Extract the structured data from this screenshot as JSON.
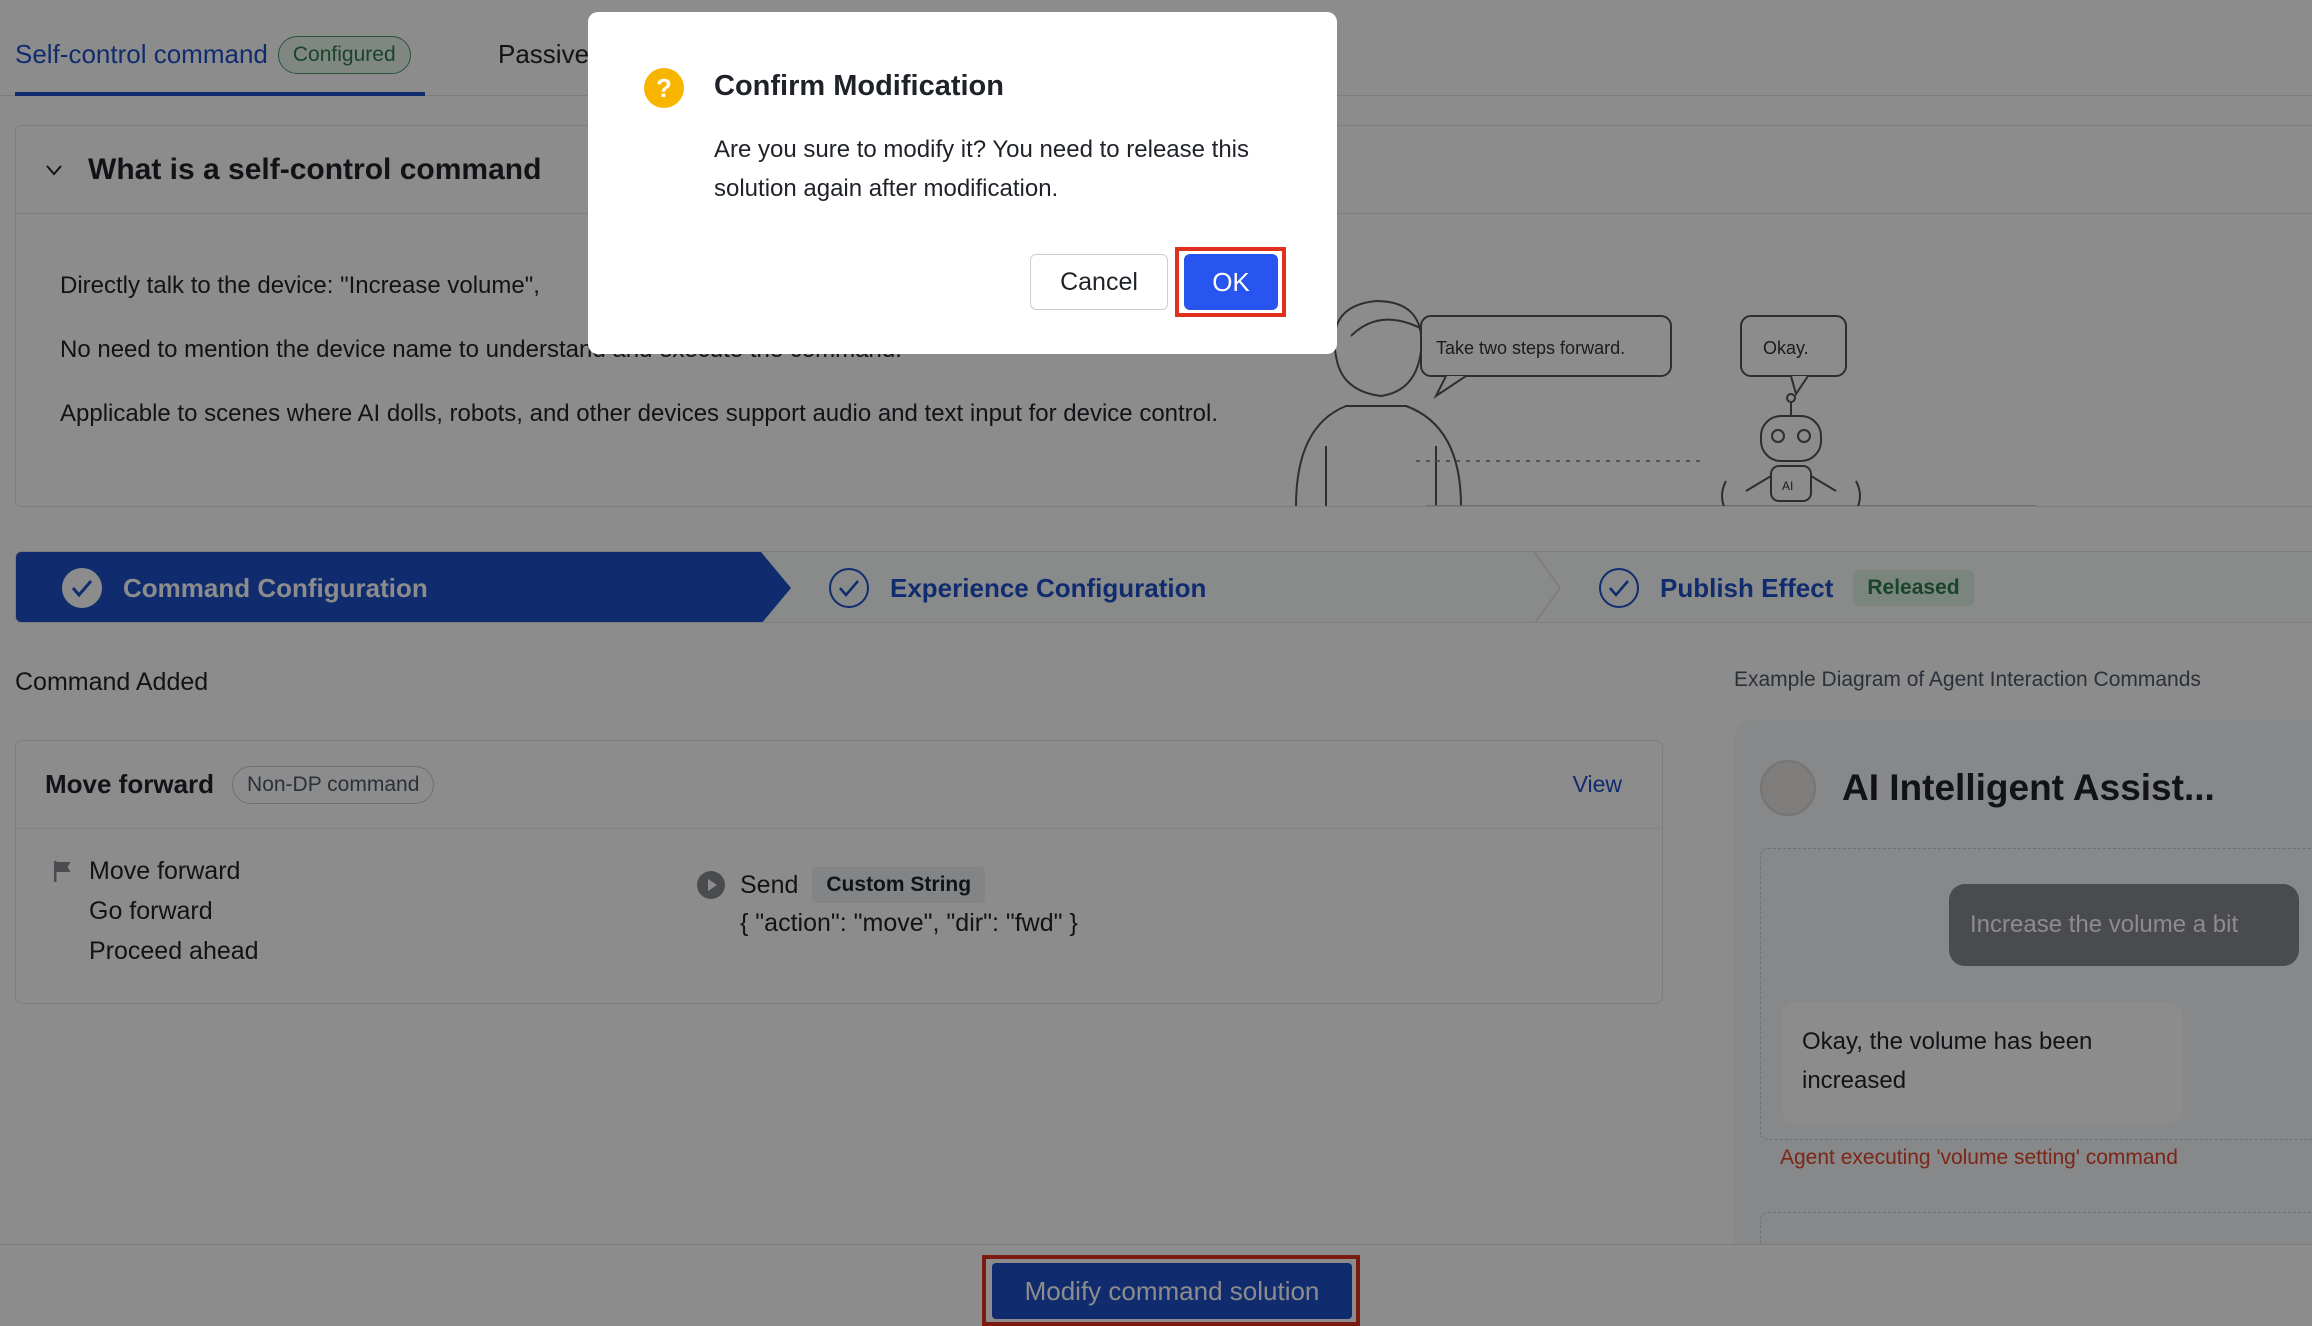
{
  "tabs": {
    "active_label": "Self-control command",
    "active_badge": "Configured",
    "second_label": "Passive"
  },
  "intro": {
    "title": "What is a self-control command",
    "line1": "Directly talk to the device: \"Increase volume\",",
    "line2": "No need to mention the device name to understand and execute the command.",
    "line3": "Applicable to scenes where AI dolls, robots, and other devices support audio and text input for device control.",
    "illustration": {
      "bubble_left": "Take two steps forward.",
      "bubble_right": "Okay.",
      "robot_label": "AI"
    }
  },
  "steps": [
    {
      "label": "Command Configuration"
    },
    {
      "label": "Experience Configuration"
    },
    {
      "label": "Publish Effect",
      "badge": "Released"
    }
  ],
  "commands": {
    "heading": "Command Added",
    "card": {
      "title": "Move forward",
      "type_badge": "Non-DP command",
      "view_label": "View",
      "phrases": [
        "Move forward",
        "Go forward",
        "Proceed ahead"
      ],
      "send_label": "Send",
      "send_type": "Custom String",
      "payload": "{ \"action\": \"move\", \"dir\": \"fwd\" }"
    }
  },
  "example": {
    "title": "Example Diagram of Agent Interaction Commands",
    "assistant_name": "AI Intelligent Assist...",
    "user_message": "Increase the volume a bit",
    "bot_message": "Okay, the volume has been increased",
    "note": "Agent executing 'volume setting' command"
  },
  "bottom": {
    "modify_label": "Modify command solution"
  },
  "modal": {
    "title": "Confirm Modification",
    "message": "Are you sure to modify it? You need to release this solution again after modification.",
    "cancel_label": "Cancel",
    "ok_label": "OK",
    "icon_glyph": "?"
  },
  "colors": {
    "primary": "#1e50c8",
    "ok_button": "#2854f0",
    "highlight": "#e0301e",
    "warning_icon": "#f7b500",
    "success": "#2f7d4e"
  }
}
